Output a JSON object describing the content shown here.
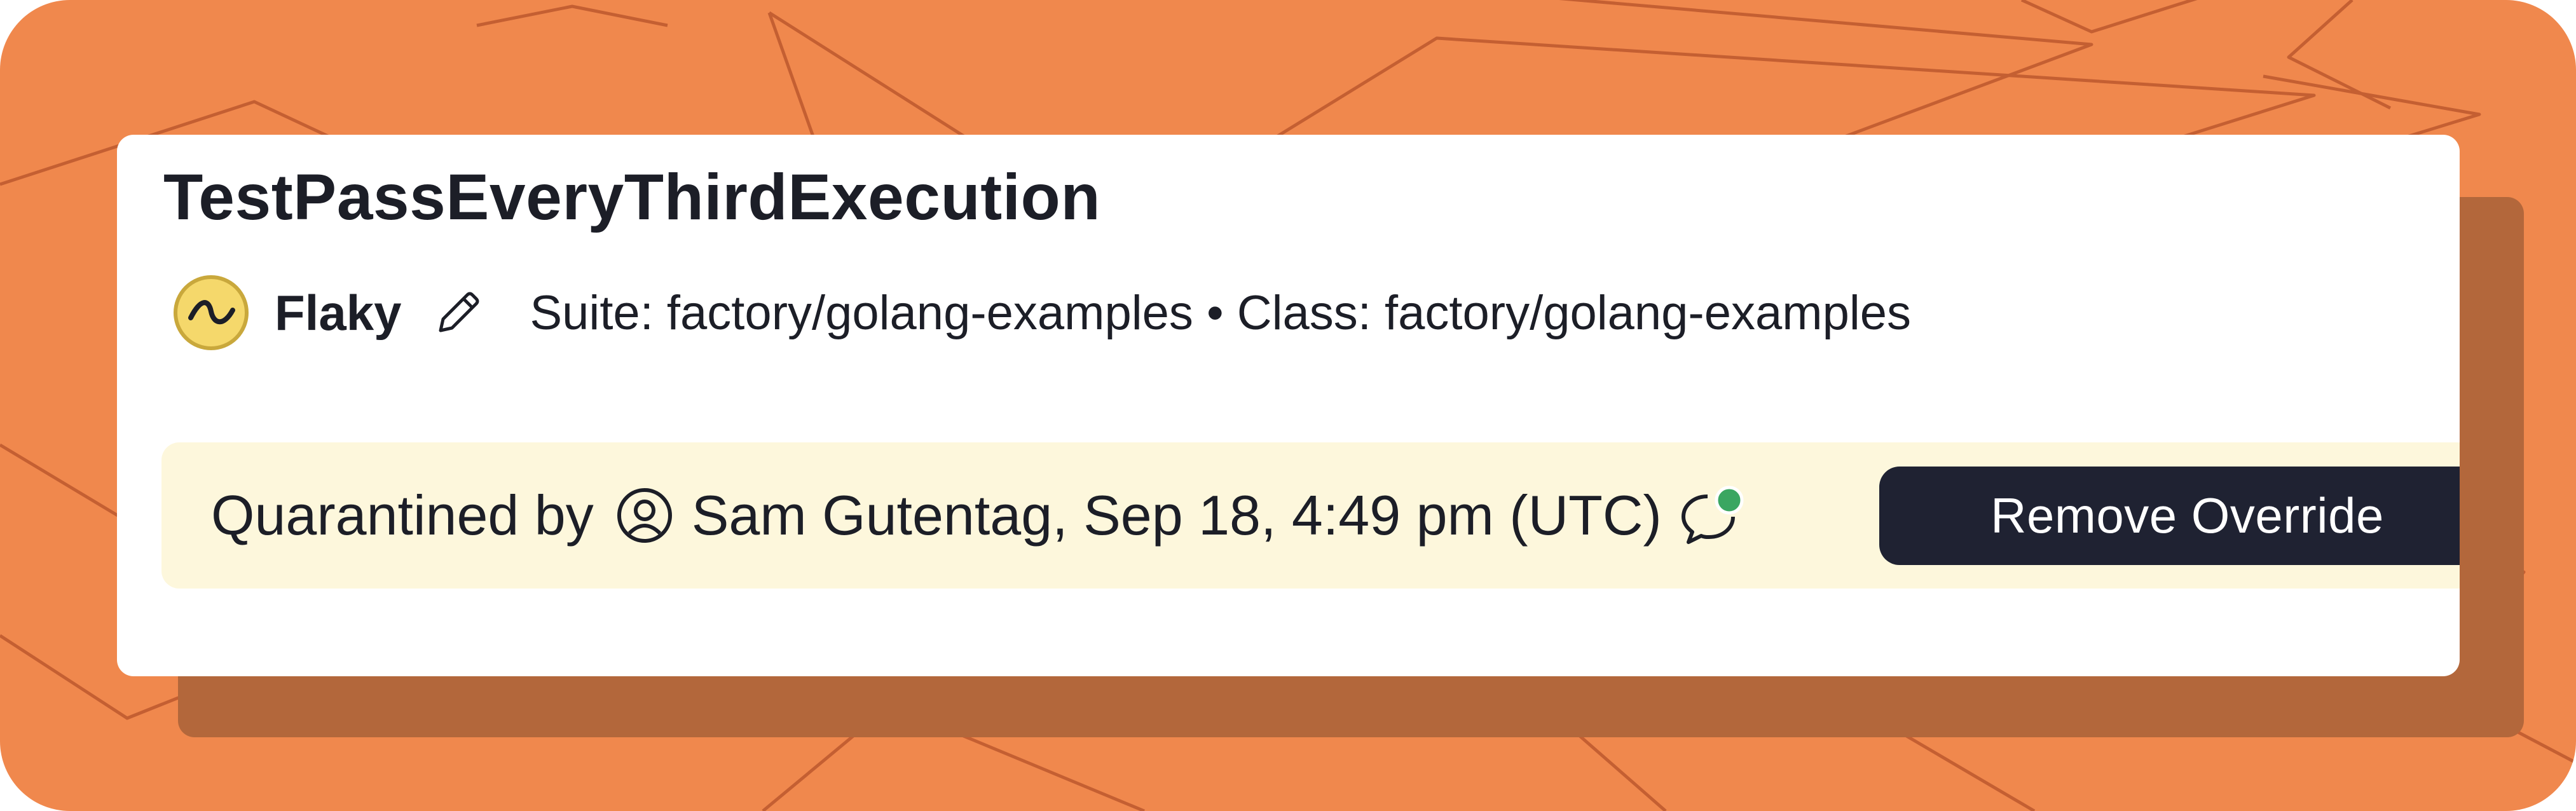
{
  "test": {
    "name": "TestPassEveryThirdExecution",
    "status": "Flaky",
    "meta": "Suite: factory/golang-examples • Class: factory/golang-examples"
  },
  "override": {
    "prefix": "Quarantined by",
    "detail": "Sam Gutentag, Sep 18, 4:49 pm (UTC)",
    "button_label": "Remove Override"
  },
  "icons": {
    "status": "flaky-status-icon",
    "edit": "pencil-icon",
    "user": "user-circle-icon",
    "comment": "chat-bubble-icon"
  },
  "colors": {
    "background": "#f0884d",
    "banner": "#fdf7dc",
    "button": "#1f2232",
    "flaky_badge": "#f5d86b",
    "notification_dot": "#3aa661"
  }
}
